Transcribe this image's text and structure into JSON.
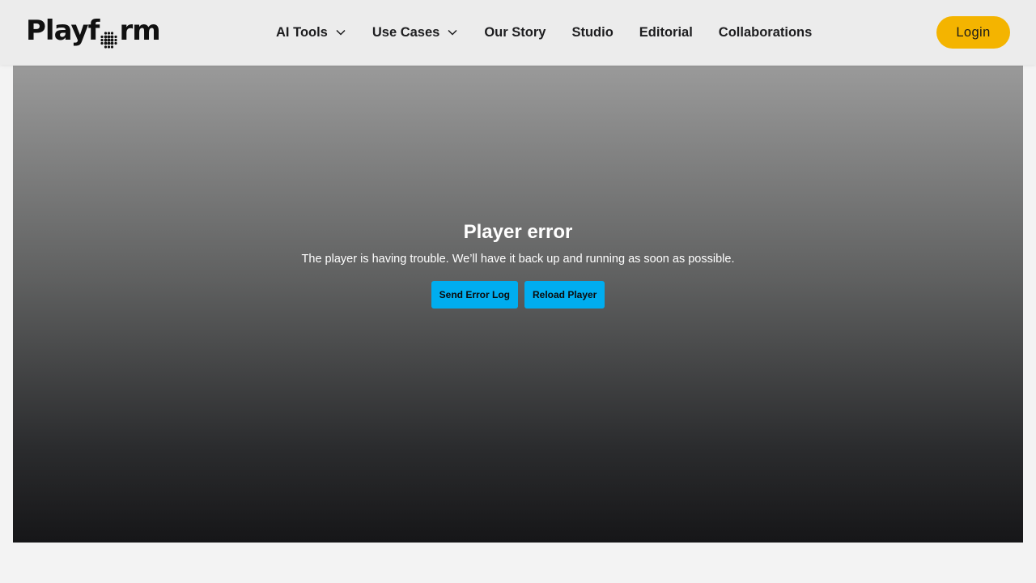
{
  "brand": {
    "logo_prefix": "Playf",
    "logo_suffix": "rm"
  },
  "nav": {
    "items": [
      {
        "label": "AI Tools",
        "dropdown": true
      },
      {
        "label": "Use Cases",
        "dropdown": true
      },
      {
        "label": "Our Story",
        "dropdown": false
      },
      {
        "label": "Studio",
        "dropdown": false
      },
      {
        "label": "Editorial",
        "dropdown": false
      },
      {
        "label": "Collaborations",
        "dropdown": false
      }
    ],
    "login_label": "Login"
  },
  "player": {
    "error_title": "Player error",
    "error_message": "The player is having trouble. We’ll have it back up and running as soon as possible.",
    "send_log_label": "Send Error Log",
    "reload_label": "Reload Player"
  },
  "colors": {
    "accent": "#f4b400",
    "error_button": "#00adef",
    "header_bg": "#ececec",
    "page_bg": "#f3f3f3"
  }
}
